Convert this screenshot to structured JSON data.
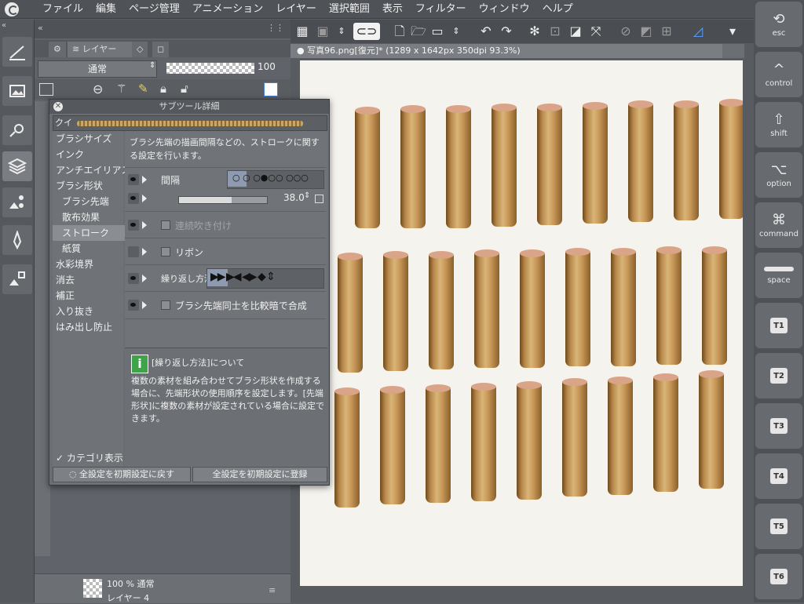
{
  "menu": [
    "ファイル",
    "編集",
    "ページ管理",
    "アニメーション",
    "レイヤー",
    "選択範囲",
    "表示",
    "フィルター",
    "ウィンドウ",
    "ヘルプ"
  ],
  "keys": [
    {
      "glyph": "⟲",
      "label": "esc"
    },
    {
      "glyph": "^",
      "label": "control"
    },
    {
      "glyph": "⇧",
      "label": "shift"
    },
    {
      "glyph": "⌥",
      "label": "option"
    },
    {
      "glyph": "⌘",
      "label": "command"
    },
    {
      "glyph": "",
      "label": "space"
    },
    {
      "box": "T1"
    },
    {
      "box": "T2"
    },
    {
      "box": "T3"
    },
    {
      "box": "T4"
    },
    {
      "box": "T5"
    },
    {
      "box": "T6"
    }
  ],
  "layer_panel": {
    "tab_label": "レイヤー",
    "blend_mode": "通常",
    "opacity": "100",
    "layer_item_blend": "100 % 通常",
    "layer_item_name": "レイヤー 4"
  },
  "canvas": {
    "doc_tab": "写真96.png[復元]* (1289 x 1642px 350dpi 93.3%)"
  },
  "dialog": {
    "title": "サブツール詳細",
    "preview_name": "クイ",
    "categories": [
      "ブラシサイズ",
      "インク",
      "アンチエイリアス",
      "ブラシ形状",
      "ブラシ先端",
      "散布効果",
      "ストローク",
      "紙質",
      "水彩境界",
      "消去",
      "補正",
      "入り抜き",
      "はみ出し防止"
    ],
    "selected_category": "ストローク",
    "description": "ブラシ先端の描画間隔などの、ストロークに関する設定を行います。",
    "spacing_label": "間隔",
    "spacing_value": "38.0",
    "continuous_label": "連続吹き付け",
    "ribbon_label": "リボン",
    "repeat_label": "繰り返し方法",
    "compare_label": "ブラシ先端同士を比較暗で合成",
    "info_title": "[繰り返し方法]について",
    "info_body": "複数の素材を組み合わせてブラシ形状を作成する場合に、先端形状の使用順序を設定します。[先端形状]に複数の素材が設定されている場合に設定できます。",
    "show_category": "カテゴリ表示",
    "reset_button": "全設定を初期設定に戻す",
    "register_button": "全設定を初期設定に登録"
  }
}
